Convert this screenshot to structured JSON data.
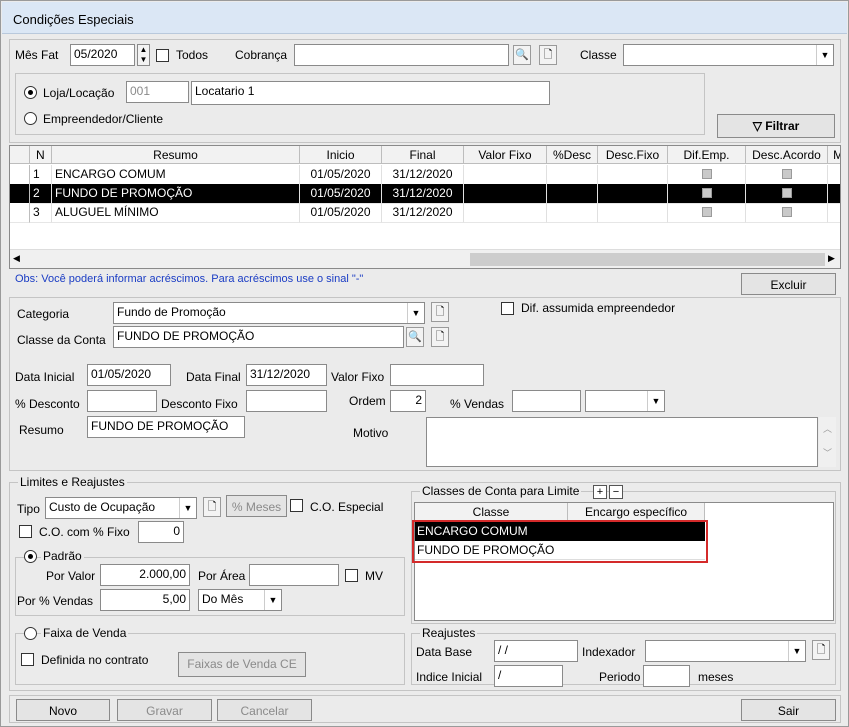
{
  "window": {
    "title": "Condições Especiais"
  },
  "filters": {
    "mes_fat_label": "Mês Fat",
    "mes_fat_value": "05/2020",
    "todos_label": "Todos",
    "cobranca_label": "Cobrança",
    "cobranca_value": "",
    "classe_label": "Classe",
    "classe_value": "",
    "loja_label": "Loja/Locação",
    "loja_code": "001",
    "loja_name": "Locatario 1",
    "empreendedor_label": "Empreendedor/Cliente",
    "filtrar_label": "Filtrar"
  },
  "grid": {
    "columns": [
      "N",
      "Resumo",
      "Inicio",
      "Final",
      "Valor Fixo",
      "%Desc",
      "Desc.Fixo",
      "Dif.Emp.",
      "Desc.Acordo",
      "Motiv"
    ],
    "rows": [
      {
        "n": "1",
        "resumo": "ENCARGO COMUM",
        "inicio": "01/05/2020",
        "final": "31/12/2020"
      },
      {
        "n": "2",
        "resumo": "FUNDO DE PROMOÇÃO",
        "inicio": "01/05/2020",
        "final": "31/12/2020"
      },
      {
        "n": "3",
        "resumo": "ALUGUEL MÍNIMO",
        "inicio": "01/05/2020",
        "final": "31/12/2020"
      }
    ],
    "selected_row": 2
  },
  "obs": "Obs: Você poderá informar acréscimos. Para acréscimos use o sinal \"-\"",
  "excluir_label": "Excluir",
  "form": {
    "categoria_label": "Categoria",
    "categoria_value": "Fundo de Promoção",
    "dif_label": "Dif. assumida empreendedor",
    "classe_conta_label": "Classe da Conta",
    "classe_conta_value": "FUNDO DE PROMOÇÃO",
    "data_inicial_label": "Data Inicial",
    "data_inicial_value": "01/05/2020",
    "data_final_label": "Data Final",
    "data_final_value": "31/12/2020",
    "valor_fixo_label": "Valor Fixo",
    "valor_fixo_value": "",
    "desconto_label": "% Desconto",
    "desconto_value": "",
    "desconto_fixo_label": "Desconto Fixo",
    "desconto_fixo_value": "",
    "ordem_label": "Ordem",
    "ordem_value": "2",
    "vendas_label": "% Vendas",
    "vendas_value": "",
    "resumo_label": "Resumo",
    "resumo_value": "FUNDO DE PROMOÇÃO",
    "motivo_label": "Motivo",
    "motivo_value": ""
  },
  "limites": {
    "legend": "Limites e Reajustes",
    "tipo_label": "Tipo",
    "tipo_value": "Custo de Ocupação",
    "meses_label": "% Meses",
    "co_especial_label": "C.O. Especial",
    "co_fixo_label": "C.O. com % Fixo",
    "co_fixo_value": "0",
    "padrao_label": "Padrão",
    "por_valor_label": "Por Valor",
    "por_valor_value": "2.000,00",
    "por_area_label": "Por Área",
    "por_area_value": "",
    "mv_label": "MV",
    "por_vendas_label": "Por % Vendas",
    "por_vendas_value": "5,00",
    "periodo_sel": "Do Mês",
    "faixa_label": "Faixa de Venda",
    "definida_label": "Definida no contrato",
    "faixas_btn": "Faixas de Venda CE"
  },
  "classes_limite": {
    "legend": "Classes de Conta para Limite",
    "columns": [
      "Classe",
      "Encargo específico"
    ],
    "rows": [
      "ENCARGO COMUM",
      "FUNDO DE PROMOÇÃO"
    ],
    "plus": "+",
    "minus": "−"
  },
  "reajustes": {
    "legend": "Reajustes",
    "data_base_label": "Data Base",
    "data_base_value": "/ /",
    "indexador_label": "Indexador",
    "indexador_value": "",
    "indice_label": "Indice Inicial",
    "indice_value": "/",
    "periodo_label": "Periodo",
    "periodo_value": "",
    "meses_label": "meses"
  },
  "buttons": {
    "novo": "Novo",
    "gravar": "Gravar",
    "cancelar": "Cancelar",
    "sair": "Sair"
  },
  "colors": {
    "title_bg": "#dbe7f5",
    "selection": "#000000",
    "highlight": "#d42a2a",
    "obs_text": "#1a3cc4"
  }
}
